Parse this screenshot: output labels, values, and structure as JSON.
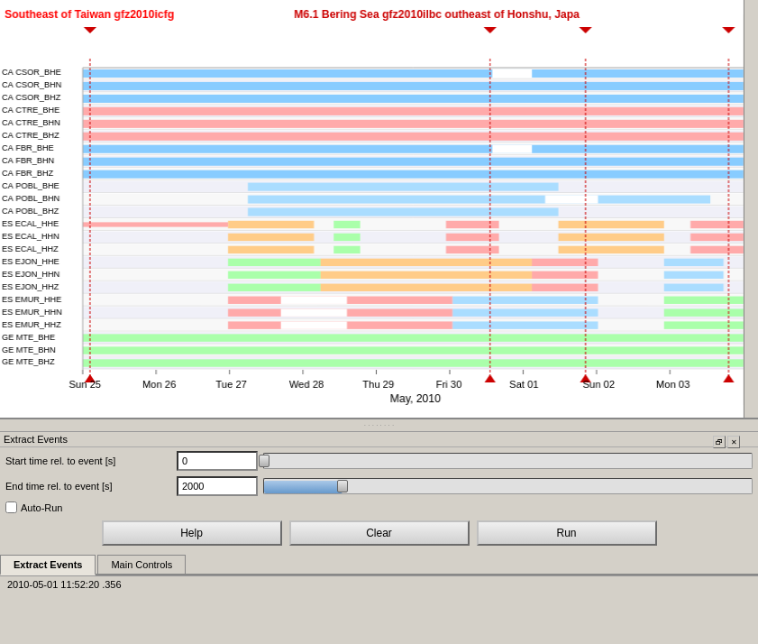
{
  "seismic": {
    "title_left": "Southeast of Taiwan gfz2010icfg",
    "title_right": "M6.1 Bering Sea gfz2010ilbc outheast of Honshu, Japa",
    "timeline": {
      "labels": [
        "Sun 25",
        "Mon 26",
        "Tue 27",
        "Wed 28",
        "Thu 29",
        "Fri 30",
        "Sat 01",
        "Sun 02",
        "Mon 03"
      ],
      "sublabel": "May, 2010"
    },
    "channels": [
      "CA CSOR_BHE",
      "CA CSOR_BHN",
      "CA CSOR_BHZ",
      "CA CTRE_BHE",
      "CA CTRE_BHN",
      "CA CTRE_BHZ",
      "CA FBR_BHE",
      "CA FBR_BHN",
      "CA FBR_BHZ",
      "CA POBL_BHE",
      "CA POBL_BHN",
      "CA POBL_BHZ",
      "ES ECAL_HHE",
      "ES ECAL_HHN",
      "ES ECAL_HHZ",
      "ES EJON_HHE",
      "ES EJON_HHN",
      "ES EJON_HHZ",
      "ES EMUR_HHE",
      "ES EMUR_HHN",
      "ES EMUR_HHZ",
      "GE MTE_BHE",
      "GE MTE_BHN",
      "GE MTE_BHZ"
    ]
  },
  "extract_events": {
    "title": "Extract Events",
    "start_time_label": "Start time rel. to event [s]",
    "start_time_value": "0",
    "end_time_label": "End time rel. to event [s]",
    "end_time_value": "2000",
    "start_slider_pct": 0,
    "end_slider_pct": 16,
    "autorun_label": "Auto-Run",
    "autorun_checked": false,
    "buttons": {
      "help": "Help",
      "clear": "Clear",
      "run": "Run"
    }
  },
  "tabs": [
    {
      "label": "Extract Events",
      "active": true
    },
    {
      "label": "Main Controls",
      "active": false
    }
  ],
  "status_bar": {
    "text": "2010-05-01 11:52:20 .356"
  },
  "window_controls": {
    "restore": "🗗",
    "close": "✕"
  }
}
